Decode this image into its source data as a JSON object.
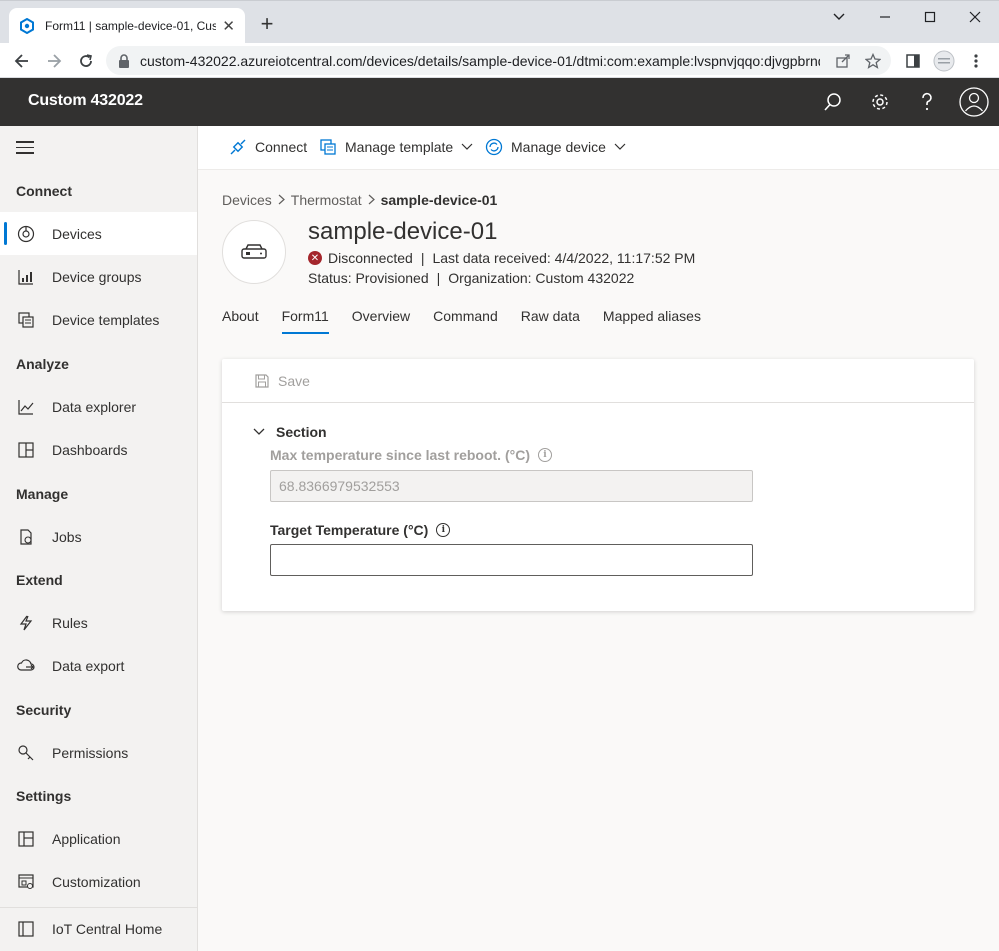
{
  "browser": {
    "tab_title": "Form11 | sample-device-01, Custom 432022",
    "tab_close": "✕",
    "new_tab": "+",
    "url": "custom-432022.azureiotcentral.com/devices/details/sample-device-01/dtmi:com:example:lvspnvjqqo:djvgpbrnq"
  },
  "app": {
    "brand": "Custom 432022"
  },
  "sidebar": {
    "sections": {
      "connect": "Connect",
      "analyze": "Analyze",
      "manage": "Manage",
      "extend": "Extend",
      "security": "Security",
      "settings": "Settings"
    },
    "items": {
      "devices": "Devices",
      "device_groups": "Device groups",
      "device_templates": "Device templates",
      "data_explorer": "Data explorer",
      "dashboards": "Dashboards",
      "jobs": "Jobs",
      "rules": "Rules",
      "data_export": "Data export",
      "permissions": "Permissions",
      "application": "Application",
      "customization": "Customization",
      "iot_central_home": "IoT Central Home"
    }
  },
  "commandbar": {
    "connect": "Connect",
    "manage_template": "Manage template",
    "manage_device": "Manage device"
  },
  "breadcrumb": {
    "devices": "Devices",
    "thermostat": "Thermostat",
    "current": "sample-device-01"
  },
  "device": {
    "name": "sample-device-01",
    "connection": "Disconnected",
    "last_data": "Last data received: 4/4/2022, 11:17:52 PM",
    "status": "Status: Provisioned",
    "organization": "Organization: Custom 432022"
  },
  "tabs": {
    "about": "About",
    "form11": "Form11",
    "overview": "Overview",
    "command": "Command",
    "raw_data": "Raw data",
    "mapped_aliases": "Mapped aliases"
  },
  "form": {
    "save": "Save",
    "section": "Section",
    "max_temp_label": "Max temperature since last reboot. (°C)",
    "max_temp_value": "68.8366979532553",
    "target_temp_label": "Target Temperature (°C)",
    "target_temp_value": "",
    "info_glyph": "i"
  },
  "colors": {
    "header_bg": "#323130",
    "accent": "#0078d4",
    "error": "#a4262c",
    "sidebar_bg": "#f3f2f1"
  }
}
